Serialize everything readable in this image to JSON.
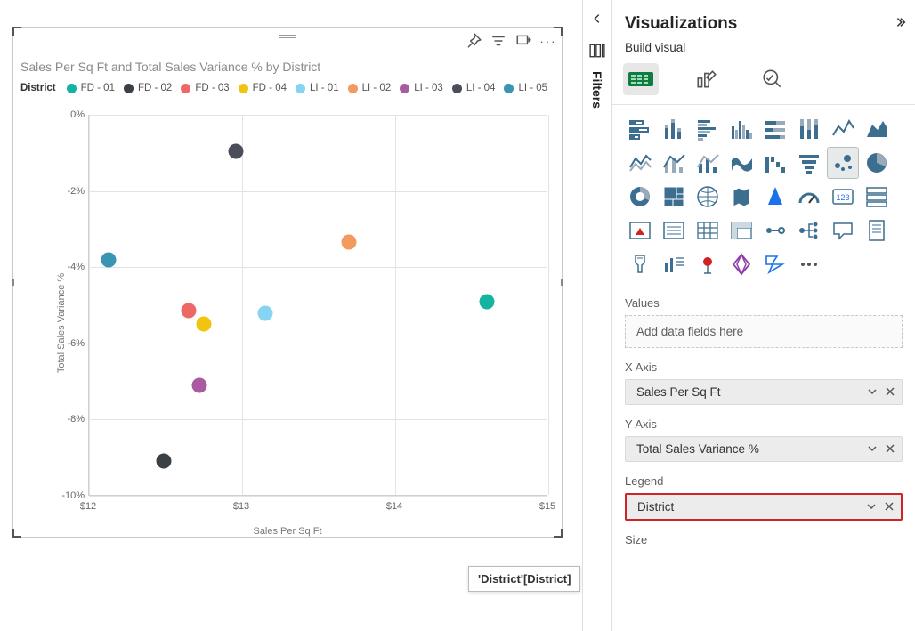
{
  "chart_data": {
    "type": "scatter",
    "title": "Sales Per Sq Ft and Total Sales Variance % by District",
    "xlabel": "Sales Per Sq Ft",
    "ylabel": "Total Sales Variance %",
    "xlim": [
      12,
      15
    ],
    "ylim": [
      -10,
      0
    ],
    "x_ticks": [
      12,
      13,
      14,
      15
    ],
    "y_ticks": [
      0,
      -2,
      -4,
      -6,
      -8,
      -10
    ],
    "y_tick_labels": [
      "0%",
      "-2%",
      "-4%",
      "-6%",
      "-8%",
      "-10%"
    ],
    "x_tick_labels": [
      "$12",
      "$13",
      "$14",
      "$15"
    ],
    "legend_title": "District",
    "series": [
      {
        "name": "FD - 01",
        "color": "#14b3a2",
        "x": 14.6,
        "y": -4.9
      },
      {
        "name": "FD - 02",
        "color": "#3a4046",
        "x": 12.49,
        "y": -9.1
      },
      {
        "name": "FD - 03",
        "color": "#ed6867",
        "x": 12.65,
        "y": -5.15
      },
      {
        "name": "FD - 04",
        "color": "#f2c40f",
        "x": 12.75,
        "y": -5.5
      },
      {
        "name": "LI - 01",
        "color": "#87d3f2",
        "x": 13.15,
        "y": -5.2
      },
      {
        "name": "LI - 02",
        "color": "#f39a5e",
        "x": 13.7,
        "y": -3.35
      },
      {
        "name": "LI - 03",
        "color": "#a95aa0",
        "x": 12.72,
        "y": -7.1
      },
      {
        "name": "LI - 04",
        "color": "#4b4d5a",
        "x": 12.96,
        "y": -0.95
      },
      {
        "name": "LI - 05",
        "color": "#3a95b3",
        "x": 12.13,
        "y": -3.8
      }
    ]
  },
  "viz_pane": {
    "title": "Visualizations",
    "subtitle": "Build visual",
    "values_label": "Values",
    "values_placeholder": "Add data fields here",
    "xaxis_label": "X Axis",
    "xaxis_field": "Sales Per Sq Ft",
    "yaxis_label": "Y Axis",
    "yaxis_field": "Total Sales Variance %",
    "legend_label": "Legend",
    "legend_field": "District",
    "size_label": "Size"
  },
  "filters": {
    "label": "Filters"
  },
  "tooltip": {
    "text": "'District'[District]"
  },
  "toolbar": {
    "pin": "Pin",
    "filter": "Filter",
    "focus": "Focus",
    "more": "More"
  }
}
